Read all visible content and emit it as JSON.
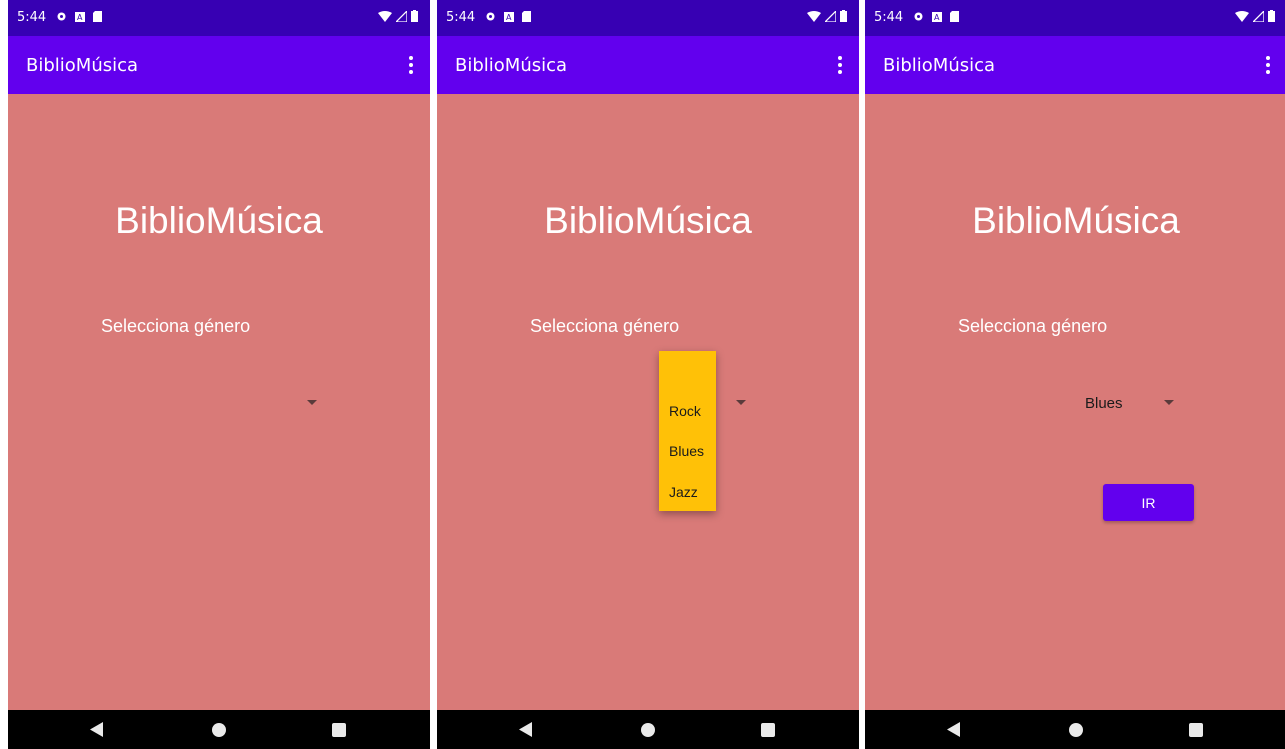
{
  "app": {
    "status_time": "5:44",
    "appbar_title": "BiblioMúsica",
    "heading": "BiblioMúsica",
    "genre_label": "Selecciona género"
  },
  "screens": [
    {
      "state": "default",
      "spinner_value": ""
    },
    {
      "state": "dropdown-open",
      "options": [
        "Rock",
        "Blues",
        "Jazz"
      ]
    },
    {
      "state": "selected",
      "spinner_value": "Blues",
      "button_label": "IR"
    }
  ],
  "colors": {
    "status_bar": "#3700b3",
    "app_bar": "#6200ee",
    "background": "#d97a78",
    "dropdown": "#ffc107",
    "button": "#6200ee"
  },
  "icons": [
    "settings-icon",
    "a-icon",
    "sd-card-icon",
    "wifi-icon",
    "signal-icon",
    "battery-icon",
    "more-vert-icon",
    "back-icon",
    "home-icon",
    "recents-icon"
  ]
}
